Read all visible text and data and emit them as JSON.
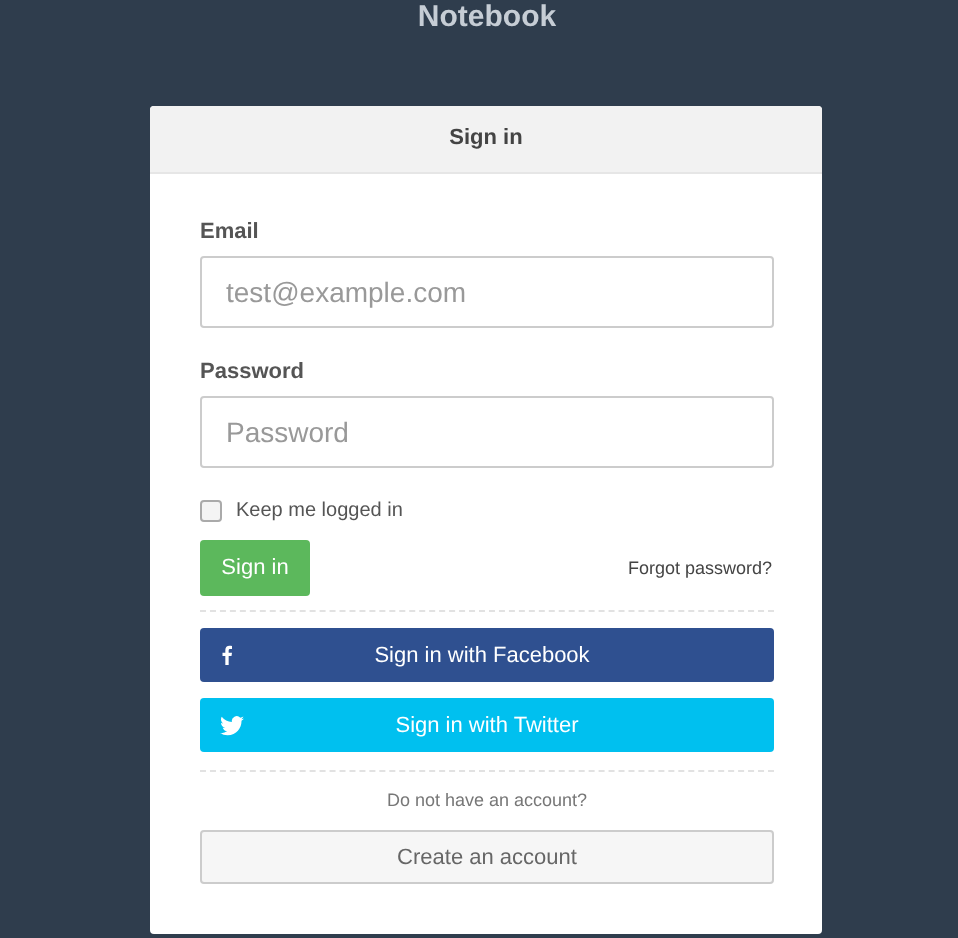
{
  "app_title": "Notebook",
  "panel": {
    "title": "Sign in",
    "fields": [
      {
        "label": "Email",
        "placeholder": "test@example.com"
      },
      {
        "label": "Password",
        "placeholder": "Password"
      }
    ],
    "remember": {
      "label": "Keep me logged in",
      "checked": false
    },
    "submit": "Sign in",
    "forgot": "Forgot password?",
    "social": [
      {
        "kind": "facebook",
        "label": "Sign in with Facebook"
      },
      {
        "kind": "twitter",
        "label": "Sign in with Twitter"
      }
    ],
    "signup_prompt": "Do not have an account?",
    "signup_button": "Create an account"
  }
}
